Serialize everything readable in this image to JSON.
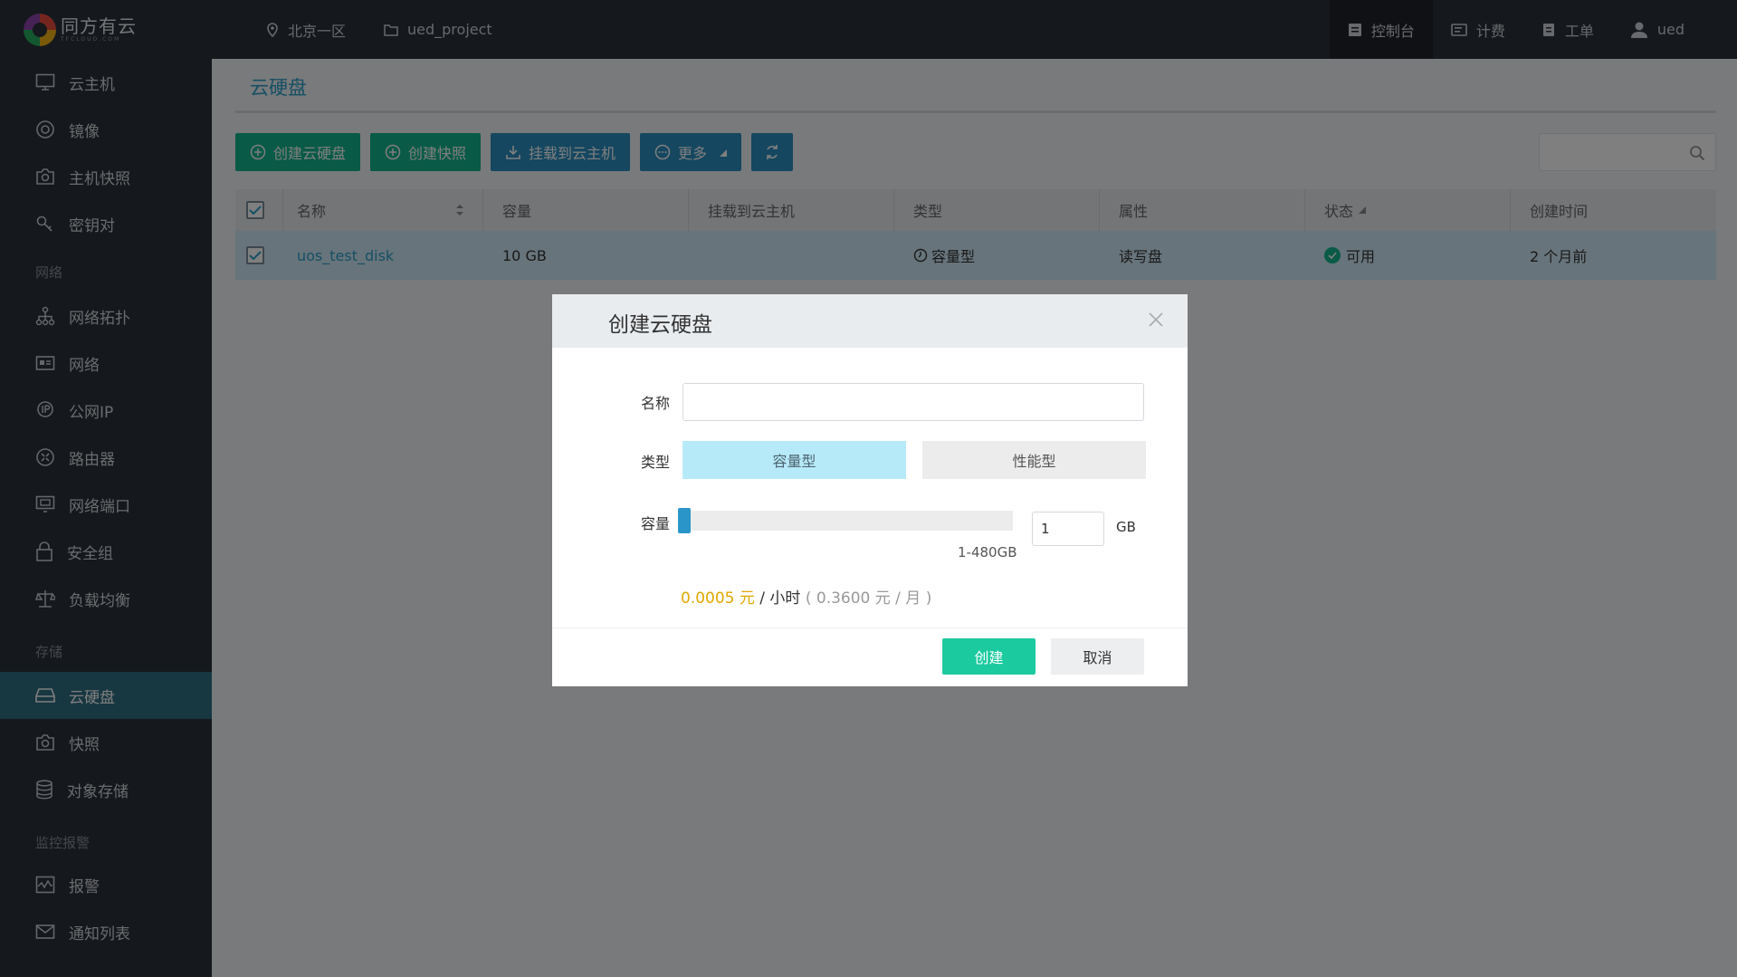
{
  "header": {
    "logo_text": "同方有云",
    "logo_subtext": "TFCLOUD.COM",
    "region": "北京一区",
    "project": "ued_project",
    "right_items": [
      "控制台",
      "计费",
      "工单",
      "ued"
    ]
  },
  "sidebar": {
    "items": [
      {
        "label": "云主机"
      },
      {
        "label": "镜像"
      },
      {
        "label": "主机快照"
      },
      {
        "label": "密钥对"
      },
      {
        "label": "网络拓扑"
      },
      {
        "label": "网络"
      },
      {
        "label": "公网IP"
      },
      {
        "label": "路由器"
      },
      {
        "label": "网络端口"
      },
      {
        "label": "安全组"
      },
      {
        "label": "负载均衡"
      },
      {
        "label": "云硬盘"
      },
      {
        "label": "快照"
      },
      {
        "label": "对象存储"
      },
      {
        "label": "报警"
      },
      {
        "label": "通知列表"
      }
    ],
    "groups": [
      "网络",
      "存储",
      "监控报警"
    ],
    "active": "云硬盘"
  },
  "main": {
    "title": "云硬盘",
    "toolbar": {
      "create_disk": "创建云硬盘",
      "create_snapshot": "创建快照",
      "attach": "挂载到云主机",
      "more": "更多"
    },
    "table": {
      "columns": [
        "名称",
        "容量",
        "挂载到云主机",
        "类型",
        "属性",
        "状态",
        "创建时间"
      ],
      "rows": [
        {
          "name": "uos_test_disk",
          "capacity": "10 GB",
          "attached": "",
          "type": "容量型",
          "attr": "读写盘",
          "status": "可用",
          "created": "2 个月前"
        }
      ]
    }
  },
  "dialog": {
    "title": "创建云硬盘",
    "name_label": "名称",
    "name_value": "",
    "type_label": "类型",
    "type_options": [
      "容量型",
      "性能型"
    ],
    "type_selected": "容量型",
    "capacity_label": "容量",
    "capacity_value": "1",
    "capacity_range": "1-480GB",
    "capacity_unit": "GB",
    "capacity_slider_fraction": 0.0,
    "price_hourly": "0.0005 元",
    "price_hourly_unit": " / 小时",
    "price_monthly": " ( 0.3600 元 / 月 )",
    "create_button": "创建",
    "cancel_button": "取消"
  },
  "colors": {
    "accent_blue": "#2a9ec8",
    "accent_green": "#13b58d",
    "sidebar_bg": "#2b3038",
    "price_yellow": "#e0a800"
  }
}
